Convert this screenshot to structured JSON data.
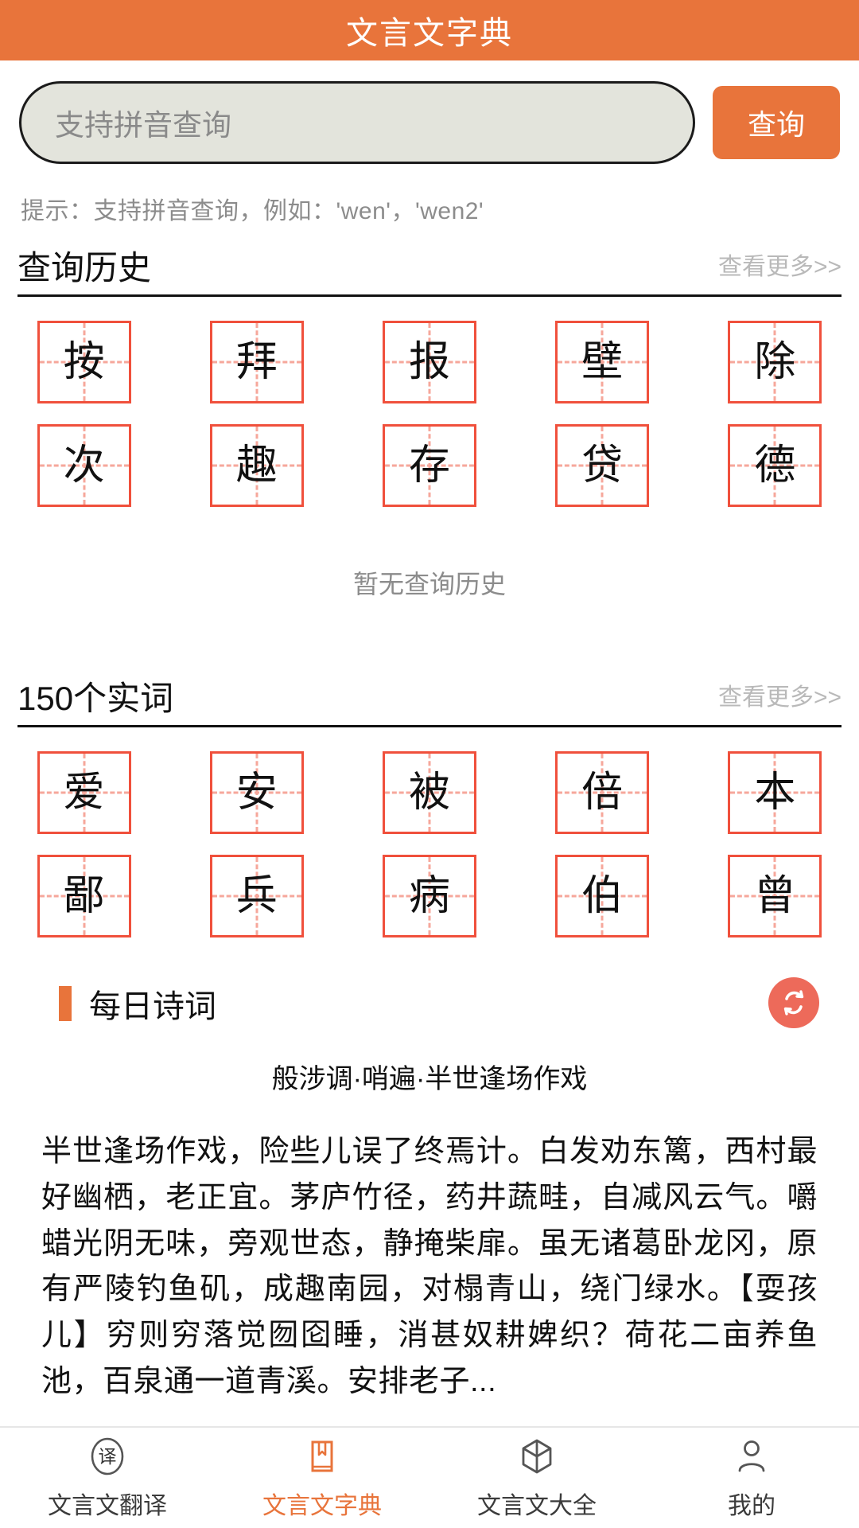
{
  "header": {
    "title": "文言文字典"
  },
  "search": {
    "placeholder": "支持拼音查询",
    "value": "",
    "button_label": "查询",
    "hint": "提示：支持拼音查询，例如：'wen'，'wen2'"
  },
  "history_section": {
    "title": "查询历史",
    "more_label": "查看更多>>",
    "characters": [
      "按",
      "拜",
      "报",
      "壁",
      "除",
      "次",
      "趣",
      "存",
      "贷",
      "德"
    ],
    "empty_text": "暂无查询历史"
  },
  "content_words_section": {
    "title": "150个实词",
    "more_label": "查看更多>>",
    "characters": [
      "爱",
      "安",
      "被",
      "倍",
      "本",
      "鄙",
      "兵",
      "病",
      "伯",
      "曾"
    ]
  },
  "daily_poem": {
    "section_title": "每日诗词",
    "refresh_icon": "refresh-icon",
    "poem_title": "般涉调·哨遍·半世逢场作戏",
    "poem_text": "半世逢场作戏，险些儿误了终焉计。白发劝东篱，西村最好幽栖，老正宜。茅庐竹径，药井蔬畦，自减风云气。嚼蜡光阴无味，旁观世态，静掩柴扉。虽无诸葛卧龙冈，原有严陵钓鱼矶，成趣南园，对榻青山，绕门绿水。【耍孩儿】穷则穷落觉囫囵睡，消甚奴耕婢织？荷花二亩养鱼池，百泉通一道青溪。安排老子..."
  },
  "tabbar": {
    "items": [
      {
        "label": "文言文翻译",
        "icon": "translate-circle-icon",
        "active": false
      },
      {
        "label": "文言文字典",
        "icon": "book-icon",
        "active": true
      },
      {
        "label": "文言文大全",
        "icon": "cube-book-icon",
        "active": false
      },
      {
        "label": "我的",
        "icon": "person-icon",
        "active": false
      }
    ]
  },
  "colors": {
    "brand_orange": "#e8743b",
    "cell_red": "#f0503c",
    "cell_guide_pink": "#f6a79b",
    "refresh_red": "#ed6a5a",
    "muted_gray": "#8c8c8c",
    "more_gray": "#b9b9b9",
    "search_bg": "#e3e4dc"
  }
}
